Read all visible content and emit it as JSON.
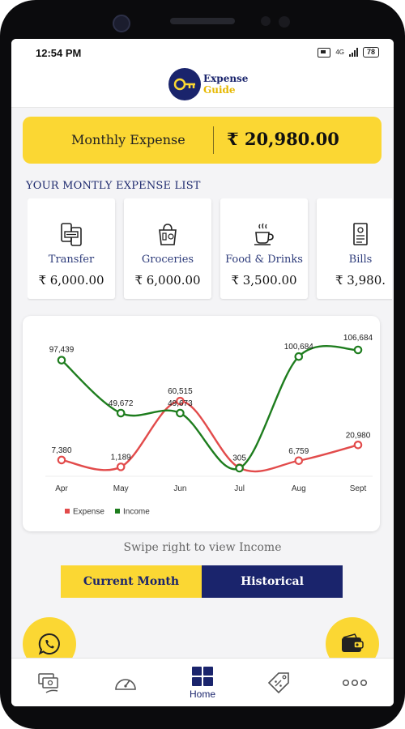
{
  "statusbar": {
    "time": "12:54 PM",
    "network": "4G",
    "battery": "78"
  },
  "app": {
    "logo_line1": "Expense",
    "logo_line2": "Guide"
  },
  "summary": {
    "label": "Monthly Expense",
    "value": "₹ 20,980.00"
  },
  "section_title": "YOUR MONTLY EXPENSE LIST",
  "categories": [
    {
      "name": "Transfer",
      "amount": "₹ 6,000.00",
      "icon": "transfer-icon"
    },
    {
      "name": "Groceries",
      "amount": "₹ 6,000.00",
      "icon": "groceries-icon"
    },
    {
      "name": "Food & Drinks",
      "amount": "₹ 3,500.00",
      "icon": "food-drinks-icon"
    },
    {
      "name": "Bills",
      "amount": "₹ 3,980.",
      "icon": "bills-icon"
    }
  ],
  "chart_data": {
    "type": "line",
    "categories": [
      "Apr",
      "May",
      "Jun",
      "Jul",
      "Aug",
      "Sept"
    ],
    "series": [
      {
        "name": "Expense",
        "values": [
          7380,
          1189,
          60515,
          305,
          6759,
          20980
        ],
        "labels": [
          "7,380",
          "1,189",
          "60,515",
          "305",
          "6,759",
          "20,980"
        ],
        "color": "#e24b4b"
      },
      {
        "name": "Income",
        "values": [
          97439,
          49672,
          49673,
          0,
          100684,
          106684
        ],
        "labels": [
          "97,439",
          "49,672",
          "49,673",
          "",
          "100,684",
          "106,684"
        ],
        "color": "#1e7d1e"
      }
    ],
    "legend": "bottom-left",
    "grid": false
  },
  "swipe_hint": "Swipe right to view Income",
  "toggle": {
    "current": "Current Month",
    "historical": "Historical"
  },
  "nav": {
    "home_label": "Home"
  },
  "colors": {
    "accent_yellow": "#fbd733",
    "brand_navy": "#1a246c"
  }
}
